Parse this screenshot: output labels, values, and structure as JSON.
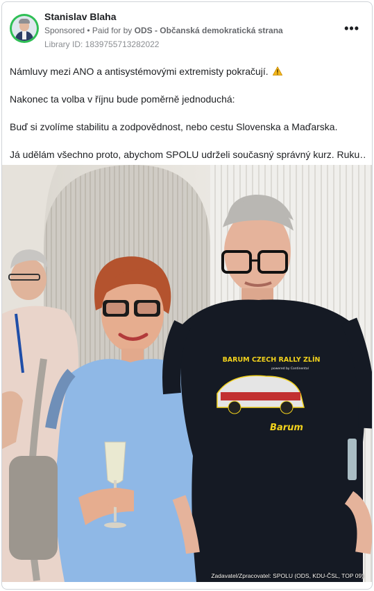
{
  "post": {
    "author": "Stanislav Blaha",
    "sponsored": "Sponsored",
    "separator": " • ",
    "paid_for_prefix": "Paid for by ",
    "paid_for_by": "ODS - Občanská demokratická strana",
    "library_id": "Library ID: 1839755713282022",
    "menu_icon": "more-horizontal-icon",
    "more_glyph": "•••",
    "body": {
      "line1": "Námluvy mezi ANO a antisystémovými extremisty pokračují.",
      "line2": "Nakonec ta volba v říjnu bude poměrně jednoduchá:",
      "line3": "Buď si zvolíme stabilitu a zodpovědnost, nebo cestu Slovenska a Maďarska.",
      "line4": "Já udělám všechno proto, abychom SPOLU udrželi současný správný kurz. Ruku…"
    },
    "warning_icon": "warning-icon",
    "image": {
      "credit": "Zadavatel/Zpracovatel: SPOLU (ODS, KDU-ČSL, TOP 09)",
      "tshirt_text": "BARUM CZECH RALLY ZLÍN",
      "tshirt_sub": "powered by Continental",
      "tshirt_brand": "Barum"
    }
  },
  "colors": {
    "avatar_ring": "#2fbf55",
    "meta_text": "#65676b",
    "tshirt_yellow": "#f2d21c"
  }
}
